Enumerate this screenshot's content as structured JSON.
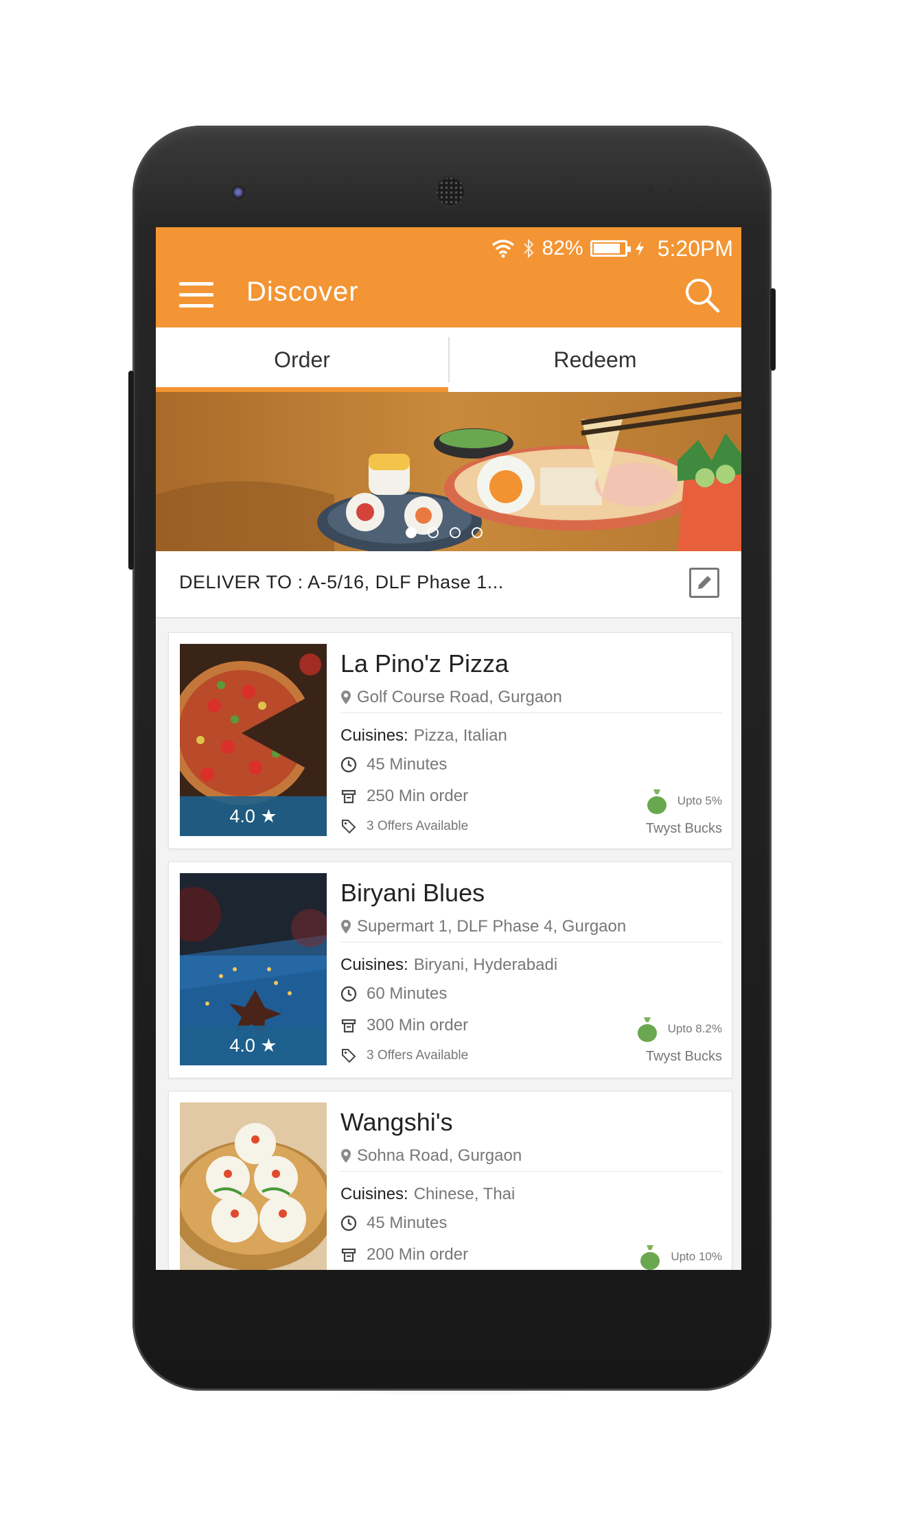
{
  "status_bar": {
    "battery": "82%",
    "time": "5:20PM"
  },
  "app_bar": {
    "title": "Discover"
  },
  "tabs": [
    {
      "label": "Order",
      "active": true
    },
    {
      "label": "Redeem",
      "active": false
    }
  ],
  "banner": {
    "slides": 4,
    "active_slide": 1
  },
  "delivery": {
    "text": "DELIVER TO : A-5/16, DLF Phase 1..."
  },
  "restaurants": [
    {
      "name": "La Pino'z Pizza",
      "address": "Golf Course Road, Gurgaon",
      "cuisines_label": "Cuisines:",
      "cuisines": "Pizza, Italian",
      "time": "45 Minutes",
      "min_order": "250 Min order",
      "offers": "3 Offers Available",
      "rating": "4.0 ★",
      "bucks_pct": "Upto 5%",
      "bucks_label": "Twyst Bucks"
    },
    {
      "name": "Biryani Blues",
      "address": "Supermart 1, DLF Phase 4, Gurgaon",
      "cuisines_label": "Cuisines:",
      "cuisines": "Biryani, Hyderabadi",
      "time": "60 Minutes",
      "min_order": "300 Min order",
      "offers": "3 Offers Available",
      "rating": "4.0 ★",
      "bucks_pct": "Upto 8.2%",
      "bucks_label": "Twyst Bucks"
    },
    {
      "name": "Wangshi's",
      "address": "Sohna Road, Gurgaon",
      "cuisines_label": "Cuisines:",
      "cuisines": "Chinese, Thai",
      "time": "45 Minutes",
      "min_order": "200 Min order",
      "bucks_pct": "Upto 10%"
    }
  ],
  "colors": {
    "accent": "#f39534",
    "rating_bg": "#1e608c",
    "bucks_bag": "#6aa84f"
  },
  "icons": [
    "wifi-icon",
    "bluetooth-icon",
    "battery-icon",
    "charging-icon",
    "menu-icon",
    "search-icon",
    "pencil-icon",
    "location-pin-icon",
    "clock-icon",
    "receipt-icon",
    "tag-icon",
    "money-bag-icon"
  ]
}
